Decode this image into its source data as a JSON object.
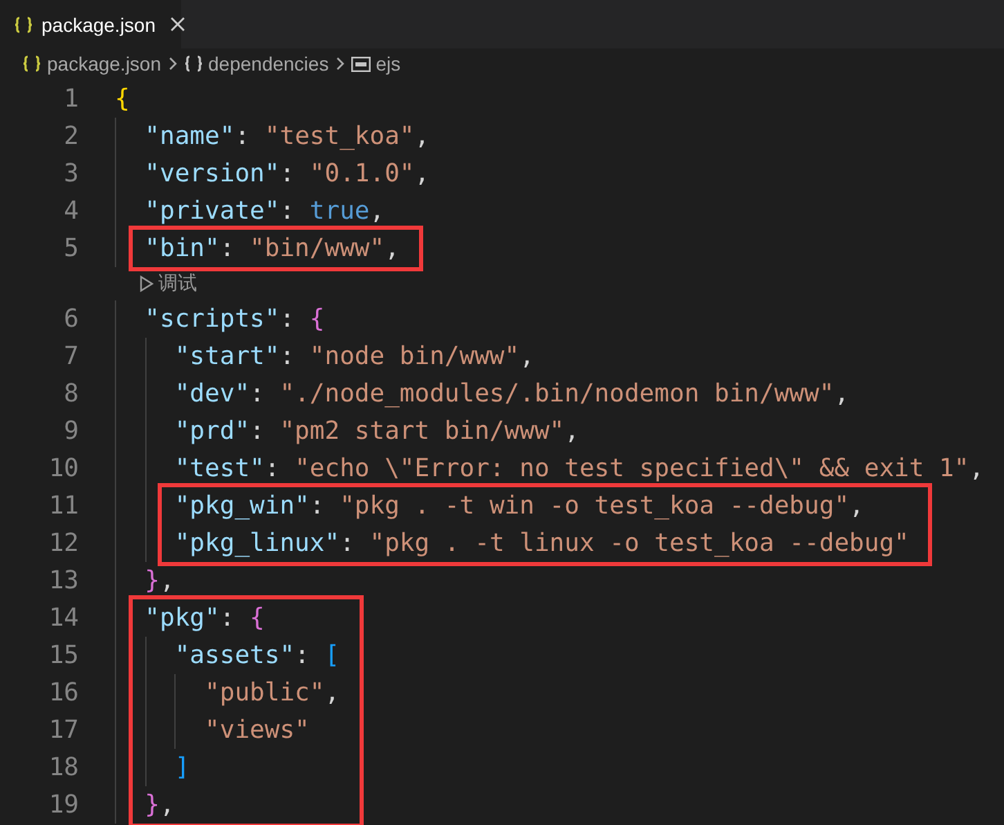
{
  "tab": {
    "title": "package.json",
    "selected": true
  },
  "breadcrumbs": [
    {
      "label": "package.json",
      "kind": "file"
    },
    {
      "label": "dependencies",
      "kind": "object"
    },
    {
      "label": "ejs",
      "kind": "string"
    }
  ],
  "lines": [
    {
      "kind": "line",
      "number": "1",
      "tokens": [
        {
          "kind": "open",
          "text": "{"
        }
      ],
      "children": [
        {
          "kind": "line",
          "number": "2",
          "tokens": [
            {
              "kind": "key",
              "text": "\"name\""
            },
            {
              "kind": "punct",
              "text": ": "
            },
            {
              "kind": "string",
              "text": "\"test_koa\""
            },
            {
              "kind": "punct",
              "text": ","
            }
          ]
        },
        {
          "kind": "line",
          "number": "3",
          "tokens": [
            {
              "kind": "key",
              "text": "\"version\""
            },
            {
              "kind": "punct",
              "text": ": "
            },
            {
              "kind": "string",
              "text": "\"0.1.0\""
            },
            {
              "kind": "punct",
              "text": ","
            }
          ]
        },
        {
          "kind": "line",
          "number": "4",
          "tokens": [
            {
              "kind": "key",
              "text": "\"private\""
            },
            {
              "kind": "punct",
              "text": ": "
            },
            {
              "kind": "literal",
              "text": "true"
            },
            {
              "kind": "punct",
              "text": ","
            }
          ]
        },
        {
          "kind": "highlight",
          "lines": [
            {
              "kind": "line",
              "number": "5",
              "tokens": [
                {
                  "kind": "key",
                  "text": "\"bin\""
                },
                {
                  "kind": "punct",
                  "text": ": "
                },
                {
                  "kind": "string",
                  "text": "\"bin/www\""
                },
                {
                  "kind": "punct",
                  "text": ","
                }
              ]
            }
          ]
        },
        {
          "kind": "codelens",
          "label": "调试"
        },
        {
          "kind": "line",
          "number": "6",
          "tokens": [
            {
              "kind": "key",
              "text": "\"scripts\""
            },
            {
              "kind": "punct",
              "text": ": "
            },
            {
              "kind": "open",
              "text": "{"
            }
          ],
          "children": [
            {
              "kind": "line",
              "number": "7",
              "tokens": [
                {
                  "kind": "key",
                  "text": "\"start\""
                },
                {
                  "kind": "punct",
                  "text": ": "
                },
                {
                  "kind": "string",
                  "text": "\"node bin/www\""
                },
                {
                  "kind": "punct",
                  "text": ","
                }
              ]
            },
            {
              "kind": "line",
              "number": "8",
              "tokens": [
                {
                  "kind": "key",
                  "text": "\"dev\""
                },
                {
                  "kind": "punct",
                  "text": ": "
                },
                {
                  "kind": "string",
                  "text": "\"./node_modules/.bin/nodemon bin/www\""
                },
                {
                  "kind": "punct",
                  "text": ","
                }
              ]
            },
            {
              "kind": "line",
              "number": "9",
              "tokens": [
                {
                  "kind": "key",
                  "text": "\"prd\""
                },
                {
                  "kind": "punct",
                  "text": ": "
                },
                {
                  "kind": "string",
                  "text": "\"pm2 start bin/www\""
                },
                {
                  "kind": "punct",
                  "text": ","
                }
              ]
            },
            {
              "kind": "line",
              "number": "10",
              "tokens": [
                {
                  "kind": "key",
                  "text": "\"test\""
                },
                {
                  "kind": "punct",
                  "text": ": "
                },
                {
                  "kind": "string",
                  "text": "\"echo \\\"Error: no test specified\\\" && exit 1\""
                },
                {
                  "kind": "punct",
                  "text": ","
                }
              ]
            },
            {
              "kind": "highlight",
              "lines": [
                {
                  "kind": "line",
                  "number": "11",
                  "tokens": [
                    {
                      "kind": "key",
                      "text": "\"pkg_win\""
                    },
                    {
                      "kind": "punct",
                      "text": ": "
                    },
                    {
                      "kind": "string",
                      "text": "\"pkg . -t win -o test_koa --debug\""
                    },
                    {
                      "kind": "punct",
                      "text": ","
                    }
                  ]
                },
                {
                  "kind": "line",
                  "number": "12",
                  "tokens": [
                    {
                      "kind": "key",
                      "text": "\"pkg_linux\""
                    },
                    {
                      "kind": "punct",
                      "text": ": "
                    },
                    {
                      "kind": "string",
                      "text": "\"pkg . -t linux -o test_koa --debug\""
                    }
                  ]
                }
              ]
            }
          ]
        },
        {
          "kind": "line",
          "number": "13",
          "tokens": [
            {
              "kind": "close",
              "text": "}"
            },
            {
              "kind": "punct",
              "text": ","
            }
          ]
        },
        {
          "kind": "highlight",
          "lines": [
            {
              "kind": "line",
              "number": "14",
              "tokens": [
                {
                  "kind": "key",
                  "text": "\"pkg\""
                },
                {
                  "kind": "punct",
                  "text": ": "
                },
                {
                  "kind": "open",
                  "text": "{"
                }
              ],
              "children": [
                {
                  "kind": "line",
                  "number": "15",
                  "tokens": [
                    {
                      "kind": "key",
                      "text": "\"assets\""
                    },
                    {
                      "kind": "punct",
                      "text": ": "
                    },
                    {
                      "kind": "open",
                      "text": "["
                    }
                  ],
                  "children": [
                    {
                      "kind": "line",
                      "number": "16",
                      "tokens": [
                        {
                          "kind": "string",
                          "text": "\"public\""
                        },
                        {
                          "kind": "punct",
                          "text": ","
                        }
                      ]
                    },
                    {
                      "kind": "line",
                      "number": "17",
                      "tokens": [
                        {
                          "kind": "string",
                          "text": "\"views\""
                        }
                      ]
                    }
                  ]
                },
                {
                  "kind": "line",
                  "number": "18",
                  "tokens": [
                    {
                      "kind": "close",
                      "text": "]"
                    }
                  ]
                }
              ]
            },
            {
              "kind": "line",
              "number": "19",
              "tokens": [
                {
                  "kind": "close",
                  "text": "}"
                },
                {
                  "kind": "punct",
                  "text": ","
                }
              ]
            }
          ]
        }
      ]
    }
  ]
}
